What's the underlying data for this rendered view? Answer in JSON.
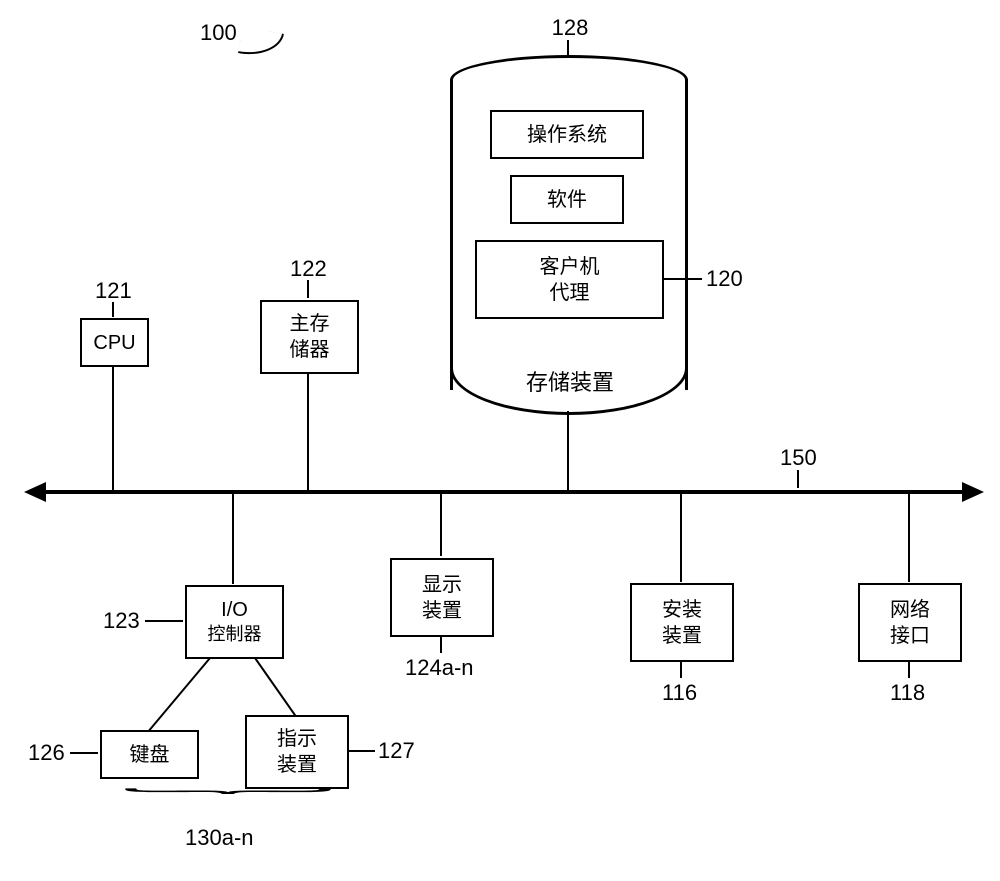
{
  "refs": {
    "fig": "100",
    "cpu": "121",
    "mainmem": "122",
    "ioctrl": "123",
    "display": "124a-n",
    "keyboard": "126",
    "pointer": "127",
    "storage": "128",
    "iodev": "130a-n",
    "install": "116",
    "netif": "118",
    "client": "120",
    "bus": "150"
  },
  "labels": {
    "cpu": "CPU",
    "mainmem": "主存\n储器",
    "ioctrl_top": "I/O",
    "ioctrl_bot": "控制器",
    "display": "显示\n装置",
    "install": "安装\n装置",
    "netif": "网络\n接口",
    "keyboard": "键盘",
    "pointer": "指示\n装置",
    "os": "操作系统",
    "software": "软件",
    "client": "客户机\n代理",
    "storage": "存储装置"
  }
}
